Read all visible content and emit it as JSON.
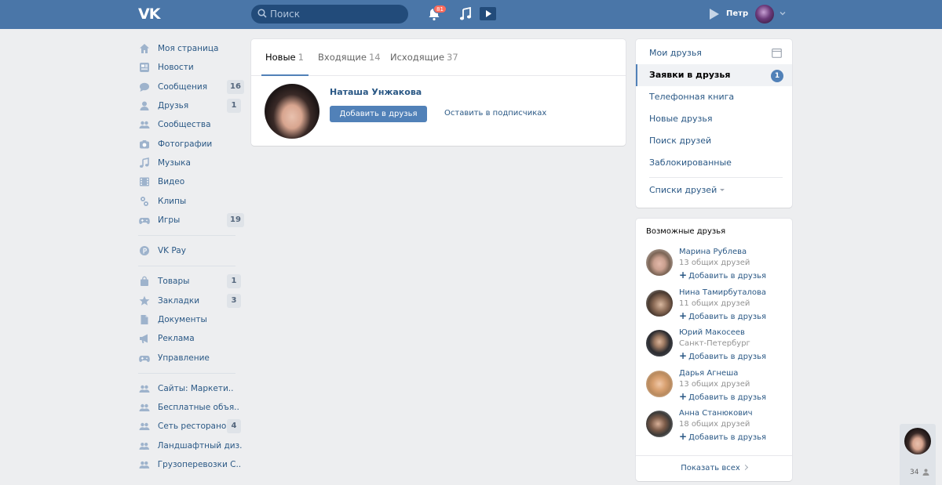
{
  "header": {
    "logo": "VK",
    "search_placeholder": "Поиск",
    "notifications_count": "81",
    "user_name": "Петр"
  },
  "nav": {
    "group1": [
      {
        "label": "Моя страница",
        "icon": "home-icon"
      },
      {
        "label": "Новости",
        "icon": "news-icon"
      },
      {
        "label": "Сообщения",
        "icon": "messages-icon",
        "badge": "16"
      },
      {
        "label": "Друзья",
        "icon": "friends-icon",
        "badge": "1"
      },
      {
        "label": "Сообщества",
        "icon": "groups-icon"
      },
      {
        "label": "Фотографии",
        "icon": "camera-icon"
      },
      {
        "label": "Музыка",
        "icon": "music-icon"
      },
      {
        "label": "Видео",
        "icon": "video-icon"
      },
      {
        "label": "Клипы",
        "icon": "clips-icon"
      },
      {
        "label": "Игры",
        "icon": "games-icon",
        "badge": "19"
      }
    ],
    "group2": [
      {
        "label": "VK Pay",
        "icon": "vkpay-icon"
      }
    ],
    "group3": [
      {
        "label": "Товары",
        "icon": "bag-icon",
        "badge": "1"
      },
      {
        "label": "Закладки",
        "icon": "star-icon",
        "badge": "3"
      },
      {
        "label": "Документы",
        "icon": "document-icon"
      },
      {
        "label": "Реклама",
        "icon": "megaphone-icon"
      },
      {
        "label": "Управление",
        "icon": "gamepad-icon"
      }
    ],
    "group4": [
      {
        "label": "Сайты: Маркети..",
        "icon": "group-icon"
      },
      {
        "label": "Бесплатные объя..",
        "icon": "group-icon"
      },
      {
        "label": "Сеть ресторано...",
        "icon": "group-icon",
        "badge": "4"
      },
      {
        "label": "Ландшафтный диз..",
        "icon": "group-icon"
      },
      {
        "label": "Грузоперевозки С...",
        "icon": "group-icon"
      }
    ]
  },
  "requests": {
    "tabs": [
      {
        "label": "Новые",
        "count": "1"
      },
      {
        "label": "Входящие",
        "count": "14"
      },
      {
        "label": "Исходящие",
        "count": "37"
      }
    ],
    "item": {
      "name": "Наташа Унжакова",
      "add_label": "Добавить в друзья",
      "keep_label": "Оставить в подписчиках"
    }
  },
  "right_menu": {
    "items": [
      "Мои друзья",
      "Заявки в друзья",
      "Телефонная книга",
      "Новые друзья",
      "Поиск друзей",
      "Заблокированные"
    ],
    "active_badge": "1",
    "lists_label": "Списки друзей"
  },
  "possible_friends": {
    "title": "Возможные друзья",
    "add_label": "Добавить в друзья",
    "items": [
      {
        "name": "Марина Рублева",
        "sub": "13 общих друзей"
      },
      {
        "name": "Нина Тамирбуталова",
        "sub": "11 общих друзей"
      },
      {
        "name": "Юрий Макосеев",
        "sub": "Санкт-Петербург"
      },
      {
        "name": "Дарья Агнеша",
        "sub": "13 общих друзей"
      },
      {
        "name": "Анна Станюкович",
        "sub": "18 общих друзей"
      }
    ],
    "show_all": "Показать всех"
  },
  "chat": {
    "count": "34"
  }
}
